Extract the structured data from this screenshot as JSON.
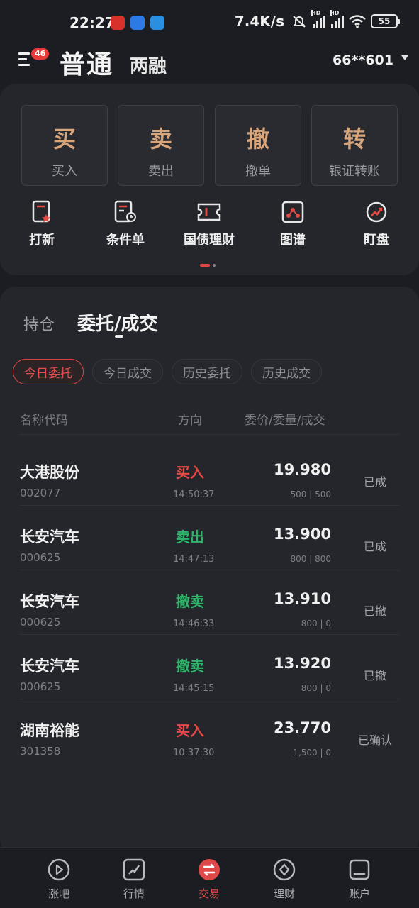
{
  "status_bar": {
    "time": "22:27",
    "network_speed": "7.4K/s",
    "battery": "55",
    "signal_label": "HD"
  },
  "header": {
    "tab_normal": "普通",
    "tab_margin": "两融",
    "menu_badge": "46",
    "account": "66**601"
  },
  "quick_actions": [
    {
      "char": "买",
      "label": "买入"
    },
    {
      "char": "卖",
      "label": "卖出"
    },
    {
      "char": "撤",
      "label": "撤单"
    },
    {
      "char": "转",
      "label": "银证转账"
    }
  ],
  "tools": [
    {
      "label": "打新",
      "icon": "new-share-icon"
    },
    {
      "label": "条件单",
      "icon": "conditional-order-icon"
    },
    {
      "label": "国债理财",
      "icon": "bond-ticket-icon"
    },
    {
      "label": "图谱",
      "icon": "chart-map-icon"
    },
    {
      "label": "盯盘",
      "icon": "watch-gauge-icon"
    }
  ],
  "orders": {
    "segment_holdings": "持仓",
    "segment_orders": "委托/成交",
    "filters": [
      "今日委托",
      "今日成交",
      "历史委托",
      "历史成交"
    ],
    "active_filter": "今日委托",
    "columns": {
      "name": "名称代码",
      "direction": "方向",
      "price": "委价/委量/成交"
    },
    "rows": [
      {
        "name": "大港股份",
        "code": "002077",
        "direction": "买入",
        "side": "buy",
        "time": "14:50:37",
        "price": "19.980",
        "qty": "500 | 500",
        "status": "已成"
      },
      {
        "name": "长安汽车",
        "code": "000625",
        "direction": "卖出",
        "side": "sell",
        "time": "14:47:13",
        "price": "13.900",
        "qty": "800 | 800",
        "status": "已成"
      },
      {
        "name": "长安汽车",
        "code": "000625",
        "direction": "撤卖",
        "side": "sell",
        "time": "14:46:33",
        "price": "13.910",
        "qty": "800 | 0",
        "status": "已撤"
      },
      {
        "name": "长安汽车",
        "code": "000625",
        "direction": "撤卖",
        "side": "sell",
        "time": "14:45:15",
        "price": "13.920",
        "qty": "800 | 0",
        "status": "已撤"
      },
      {
        "name": "湖南裕能",
        "code": "301358",
        "direction": "买入",
        "side": "buy",
        "time": "10:37:30",
        "price": "23.770",
        "qty": "1,500 | 0",
        "status": "已确认"
      }
    ]
  },
  "bottom_nav": [
    {
      "label": "涨吧",
      "icon": "play-bubble-icon"
    },
    {
      "label": "行情",
      "icon": "trend-chart-icon"
    },
    {
      "label": "交易",
      "icon": "exchange-icon"
    },
    {
      "label": "理财",
      "icon": "diamond-coin-icon"
    },
    {
      "label": "账户",
      "icon": "wallet-icon"
    }
  ],
  "colors": {
    "accent": "#e04848",
    "gold": "#d9a67c",
    "buy": "#e24a43",
    "sell": "#2fb469"
  }
}
